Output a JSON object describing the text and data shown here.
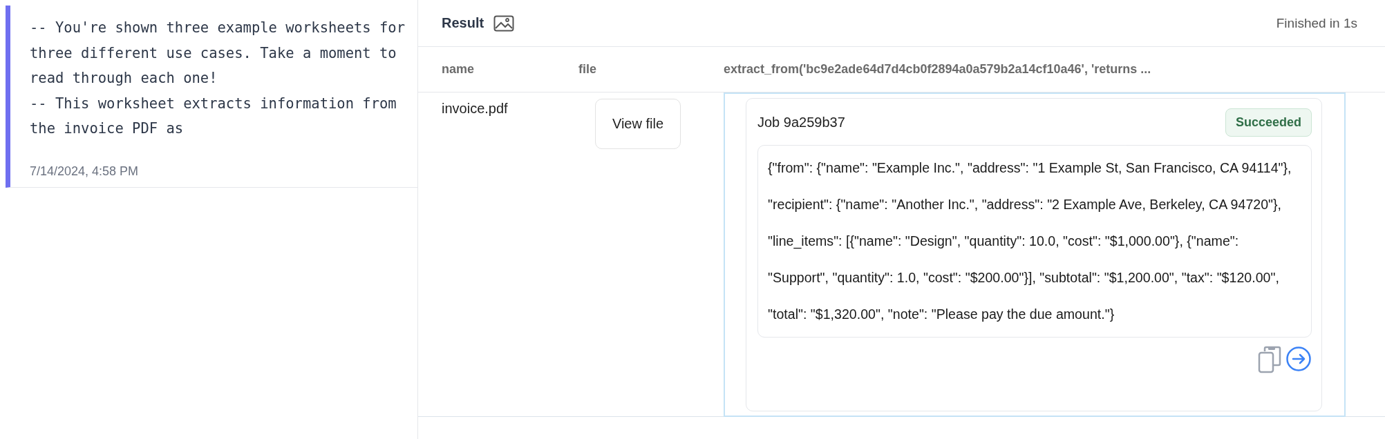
{
  "note": {
    "text": "-- You're shown three example worksheets for three different use cases. Take a moment to read through each one!\n-- This worksheet extracts information from the invoice PDF as",
    "timestamp": "7/14/2024, 4:58 PM"
  },
  "result": {
    "title": "Result",
    "status": "Finished in 1s",
    "columns": [
      "name",
      "file",
      "extract_from('bc9e2ade64d7d4cb0f2894a0a579b2a14cf10a46', 'returns ..."
    ],
    "rows": [
      {
        "name": "invoice.pdf",
        "file_button": "View file",
        "selected": true,
        "job": {
          "title": "Job 9a259b37",
          "status": "Succeeded",
          "output": "{\"from\": {\"name\": \"Example Inc.\", \"address\": \"1 Example St, San Francisco, CA 94114\"}, \"recipient\": {\"name\": \"Another Inc.\", \"address\": \"2 Example Ave, Berkeley, CA 94720\"}, \"line_items\": [{\"name\": \"Design\", \"quantity\": 10.0, \"cost\": \"$1,000.00\"}, {\"name\": \"Support\", \"quantity\": 1.0, \"cost\": \"$200.00\"}], \"subtotal\": \"$1,200.00\", \"tax\": \"$120.00\", \"total\": \"$1,320.00\", \"note\": \"Please pay the due amount.\"}"
        }
      }
    ]
  }
}
